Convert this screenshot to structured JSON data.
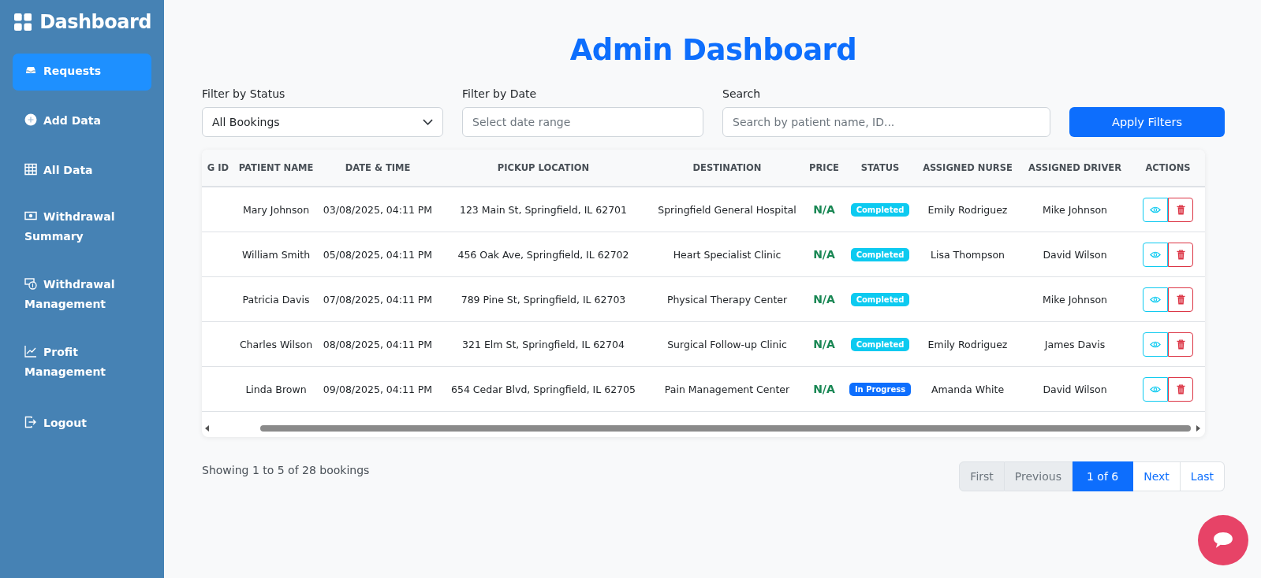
{
  "sidebar": {
    "brand": "Dashboard",
    "items": [
      {
        "label": "Requests",
        "selected": true
      },
      {
        "label": "Add Data",
        "selected": false
      },
      {
        "label": "All Data",
        "selected": false
      },
      {
        "label": "Withdrawal Summary",
        "selected": false
      },
      {
        "label": "Withdrawal Management",
        "selected": false
      },
      {
        "label": "Profit Management",
        "selected": false
      },
      {
        "label": "Logout",
        "selected": false
      }
    ]
  },
  "title": "Admin Dashboard",
  "filters": {
    "status_label": "Filter by Status",
    "status_value": "All Bookings",
    "date_label": "Filter by Date",
    "date_placeholder": "Select date range",
    "search_label": "Search",
    "search_placeholder": "Search by patient name, ID...",
    "apply_button": "Apply Filters"
  },
  "table": {
    "columns": [
      "G ID",
      "PATIENT NAME",
      "DATE & TIME",
      "PICKUP LOCATION",
      "DESTINATION",
      "PRICE",
      "STATUS",
      "ASSIGNED NURSE",
      "ASSIGNED DRIVER",
      "ACTIONS"
    ],
    "rows": [
      {
        "patient": "Mary Johnson",
        "datetime": "03/08/2025, 04:11 PM",
        "pickup": "123 Main St, Springfield, IL 62701",
        "destination": "Springfield General Hospital",
        "price": "N/A",
        "status": {
          "label": "Completed",
          "color": "#0dcaf0"
        },
        "nurse": "Emily Rodriguez",
        "driver": "Mike Johnson"
      },
      {
        "patient": "William Smith",
        "datetime": "05/08/2025, 04:11 PM",
        "pickup": "456 Oak Ave, Springfield, IL 62702",
        "destination": "Heart Specialist Clinic",
        "price": "N/A",
        "status": {
          "label": "Completed",
          "color": "#0dcaf0"
        },
        "nurse": "Lisa Thompson",
        "driver": "David Wilson"
      },
      {
        "patient": "Patricia Davis",
        "datetime": "07/08/2025, 04:11 PM",
        "pickup": "789 Pine St, Springfield, IL 62703",
        "destination": "Physical Therapy Center",
        "price": "N/A",
        "status": {
          "label": "Completed",
          "color": "#0dcaf0"
        },
        "driver": "Mike Johnson"
      },
      {
        "patient": "Charles Wilson",
        "datetime": "08/08/2025, 04:11 PM",
        "pickup": "321 Elm St, Springfield, IL 62704",
        "destination": "Surgical Follow-up Clinic",
        "price": "N/A",
        "status": {
          "label": "Completed",
          "color": "#0dcaf0"
        },
        "nurse": "Emily Rodriguez",
        "driver": "James Davis"
      },
      {
        "patient": "Linda Brown",
        "datetime": "09/08/2025, 04:11 PM",
        "pickup": "654 Cedar Blvd, Springfield, IL 62705",
        "destination": "Pain Management Center",
        "price": "N/A",
        "status": {
          "label": "In Progress",
          "color": "#0d6efd"
        },
        "nurse": "Amanda White",
        "driver": "David Wilson"
      }
    ]
  },
  "summary": "Showing 1 to 5 of 28 bookings",
  "pagination": [
    {
      "label": "First",
      "selected": false,
      "disabled": true
    },
    {
      "label": "Previous",
      "selected": false,
      "disabled": true
    },
    {
      "label": "1 of 6",
      "selected": true,
      "disabled": false
    },
    {
      "label": "Next",
      "selected": false,
      "disabled": false
    },
    {
      "label": "Last",
      "selected": false,
      "disabled": false
    }
  ]
}
